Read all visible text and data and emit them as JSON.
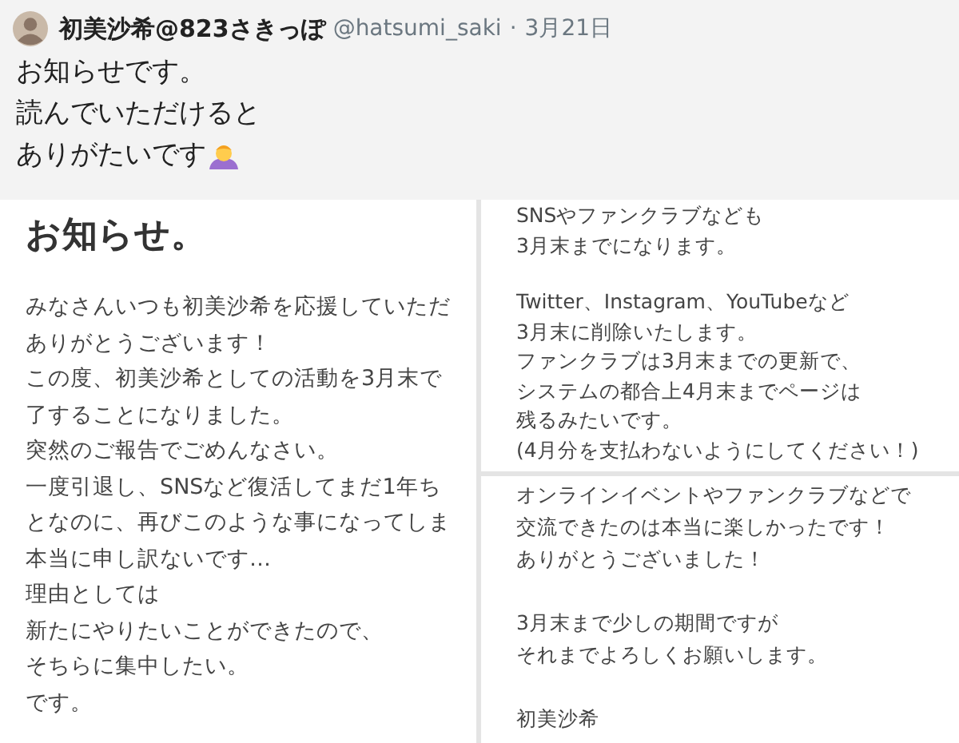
{
  "tweet": {
    "display_name": "初美沙希@823さきっぽ",
    "handle": "@hatsumi_saki",
    "separator": "·",
    "date": "3月21日",
    "text_lines": [
      "お知らせです。",
      "読んでいただけると",
      "ありがたいです"
    ]
  },
  "images": [
    {
      "kind": "notice",
      "title": "お知らせ。",
      "paragraphs": [
        [
          "みなさんいつも初美沙希を応援していただ",
          "ありがとうございます！",
          "この度、初美沙希としての活動を3月末で",
          "了することになりました。",
          "突然のご報告でごめんなさい。",
          "一度引退し、SNSなど復活してまだ1年ち",
          "となのに、再びこのような事になってしま",
          "本当に申し訳ないです…",
          "理由としては",
          "新たにやりたいことができたので、",
          "そちらに集中したい。",
          "です。"
        ]
      ]
    },
    {
      "kind": "note",
      "paragraphs": [
        [
          "SNSやファンクラブなども",
          "3月末までになります。"
        ],
        [
          "Twitter、Instagram、YouTubeなど",
          "3月末に削除いたします。",
          "ファンクラブは3月末までの更新で、",
          "システムの都合上4月末までページは",
          "残るみたいです。",
          "(4月分を支払わないようにしてください！)"
        ]
      ]
    },
    {
      "kind": "note",
      "paragraphs": [
        [
          "オンラインイベントやファンクラブなどで",
          "交流できたのは本当に楽しかったです！",
          "ありがとうございました！"
        ],
        [
          "3月末まで少しの期間ですが",
          "それまでよろしくお願いします。"
        ],
        [
          "初美沙希"
        ]
      ]
    }
  ]
}
